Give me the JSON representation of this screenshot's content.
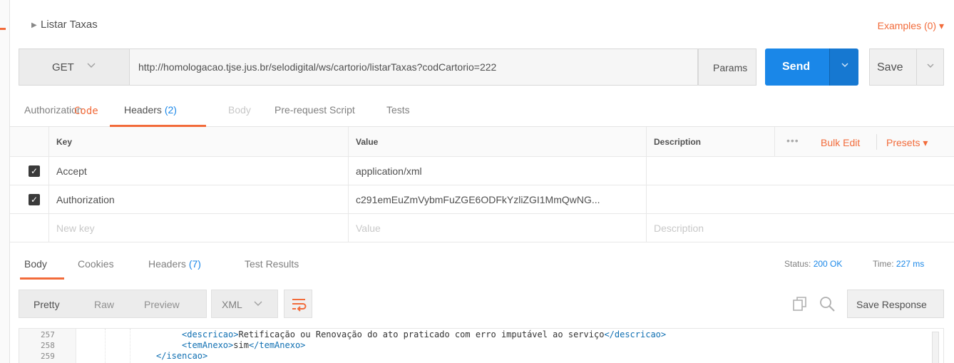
{
  "request": {
    "name": "Listar Taxas",
    "examples_label": "Examples (0) ▾",
    "method": "GET",
    "url": "http://homologacao.tjse.jus.br/selodigital/ws/cartorio/listarTaxas?codCartorio=222",
    "params_label": "Params",
    "send_label": "Send",
    "save_label": "Save"
  },
  "request_tabs": {
    "authorization": "Authorization",
    "headers": "Headers",
    "headers_count": "(2)",
    "body": "Body",
    "prerequest": "Pre-request Script",
    "tests": "Tests",
    "code": "Code"
  },
  "headers_table": {
    "columns": {
      "key": "Key",
      "value": "Value",
      "description": "Description"
    },
    "dots": "•••",
    "bulk_edit": "Bulk Edit",
    "presets": "Presets ▾",
    "rows": [
      {
        "key": "Accept",
        "value": "application/xml",
        "checked": true
      },
      {
        "key": "Authorization",
        "value": "c291emEuZmVybmFuZGE6ODFkYzliZGI1MmQwNG...",
        "checked": true
      }
    ],
    "placeholder": {
      "key": "New key",
      "value": "Value",
      "description": "Description"
    }
  },
  "response_tabs": {
    "body": "Body",
    "cookies": "Cookies",
    "headers": "Headers",
    "headers_count": "(7)",
    "test_results": "Test Results",
    "status_label": "Status:",
    "status_value": "200 OK",
    "time_label": "Time:",
    "time_value": "227 ms"
  },
  "response_view": {
    "pretty": "Pretty",
    "raw": "Raw",
    "preview": "Preview",
    "format": "XML",
    "save_response": "Save Response",
    "wrap_icon": "text-wrap-icon",
    "copy_icon": "copy-icon",
    "search_icon": "search-icon"
  },
  "editor": {
    "lines": [
      {
        "num": "257",
        "open": "<descricao>",
        "text": "Retificação ou Renovação do ato praticado com erro imputável ao serviço",
        "close": "</descricao>"
      },
      {
        "num": "258",
        "open": "<temAnexo>",
        "text": "sim",
        "close": "</temAnexo>"
      },
      {
        "num": "259",
        "open": "</isencao>",
        "text": "",
        "close": ""
      }
    ]
  },
  "colors": {
    "accent": "#f26b3a",
    "send_blue": "#1a87e8"
  }
}
